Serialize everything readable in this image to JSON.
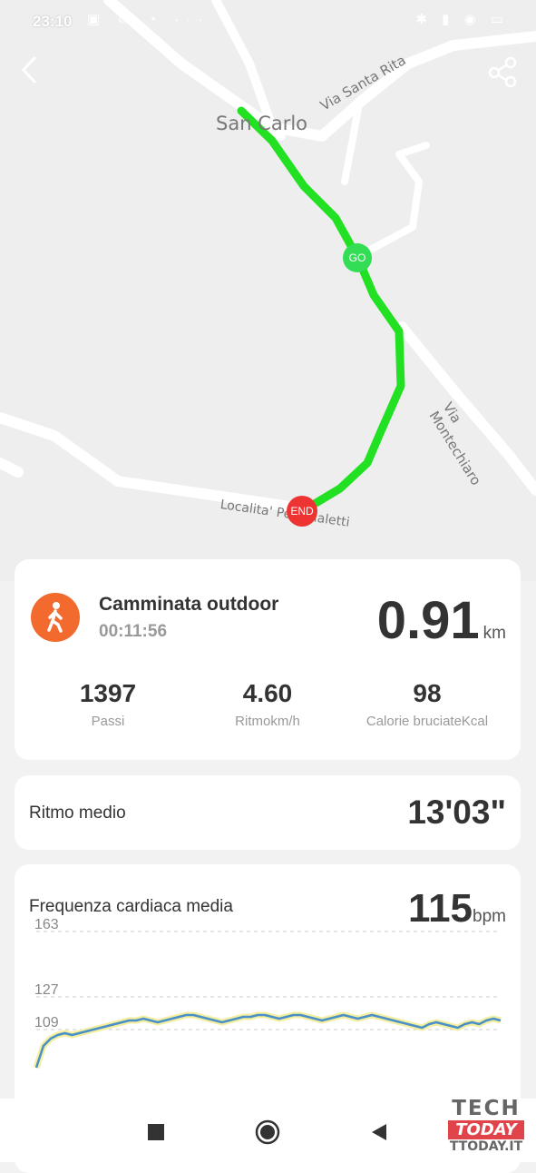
{
  "status_bar": {
    "time": "23:10",
    "left_icons": "▣ ✉ ◔ ···",
    "right_icons": "✱ ▮ ◉ ▭"
  },
  "map": {
    "labels": {
      "san_carlo": "San Carlo",
      "via_santa_rita": "Via Santa Rita",
      "via_montechiaro": "Via Montechiaro",
      "localita": "Localita' Peri Gialetti"
    },
    "markers": {
      "start": "GO",
      "end": "END"
    },
    "colors": {
      "route": "#22e022",
      "start": "#33dd55",
      "end": "#ee3333",
      "road": "#ffffff",
      "land": "#eeeeee"
    }
  },
  "summary": {
    "activity": "Camminata outdoor",
    "duration": "00:11:56",
    "distance": "0.91",
    "distance_unit": "km",
    "accent_color": "#f26a2e",
    "stats": [
      {
        "value": "1397",
        "label": "Passi"
      },
      {
        "value": "4.60",
        "label": "Ritmokm/h"
      },
      {
        "value": "98",
        "label": "Calorie bruciateKcal"
      }
    ]
  },
  "pace": {
    "label": "Ritmo medio",
    "value": "13'03\""
  },
  "heart_rate": {
    "label": "Frequenza cardiaca media",
    "value": "115",
    "unit": "bpm"
  },
  "chart_data": {
    "type": "line",
    "title": "",
    "reference_lines": [
      "163",
      "127",
      "109"
    ],
    "ylim": [
      80,
      170
    ],
    "grid": true,
    "series": [
      {
        "color": "#4a90c8",
        "values": [
          88,
          100,
          104,
          106,
          107,
          106,
          107,
          108,
          109,
          110,
          111,
          112,
          113,
          114,
          114,
          115,
          114,
          113,
          114,
          115,
          116,
          117,
          117,
          116,
          115,
          114,
          113,
          114,
          115,
          116,
          116,
          117,
          117,
          116,
          115,
          116,
          117,
          117,
          116,
          115,
          114,
          115,
          116,
          117,
          116,
          115,
          116,
          117,
          116,
          115,
          114,
          113,
          112,
          111,
          110,
          112,
          113,
          112,
          111,
          110,
          112,
          113,
          112,
          114,
          115,
          114
        ]
      }
    ]
  },
  "nav": {
    "recent": "recent-apps",
    "home": "home",
    "back": "back"
  },
  "watermark": {
    "line1": "TECH",
    "line2": "TODAY",
    "line3": "TTODAY.IT"
  }
}
